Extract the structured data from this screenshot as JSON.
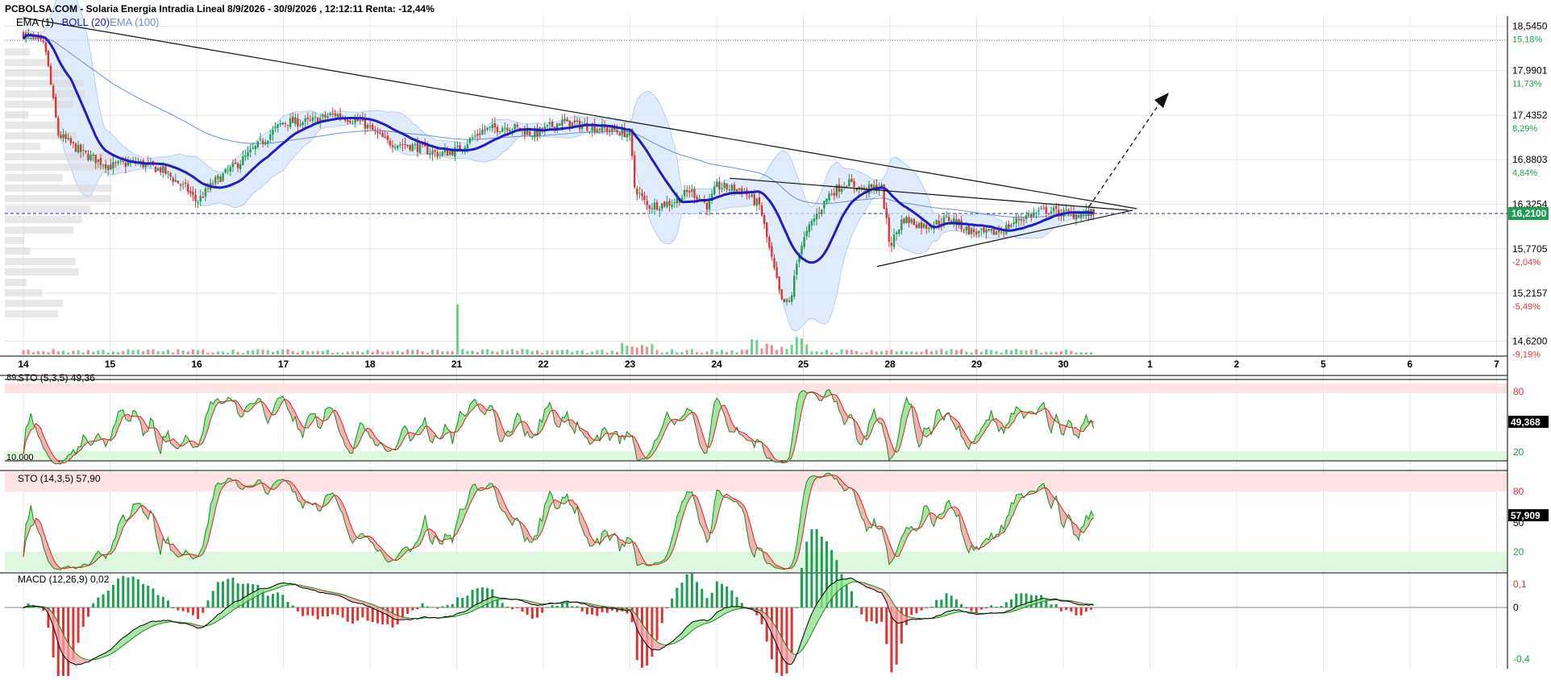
{
  "header": {
    "title": "PCBOLSA.COM - Solaria Energia Intradia Lineal 8/9/2026 - 30/9/2026 , 12:12:11 Renta: -12,44%"
  },
  "legend": {
    "ema1": "EMA (1)",
    "boll": "BOLL (20)",
    "ema100": "EMA (100)"
  },
  "colors": {
    "up": "#1e9e50",
    "down": "#e03434",
    "boll": "#1f1fbf",
    "ema100": "#6b8fd1",
    "band": "#d6e6fa",
    "overbought": "#fde3e3",
    "oversold": "#dff7df",
    "grid": "#e6e6e6"
  },
  "price_axis": {
    "ticks": [
      {
        "price": "18,5450",
        "pct": "15,18%",
        "v": 18.545
      },
      {
        "price": "17,9901",
        "pct": "11,73%",
        "v": 17.9901
      },
      {
        "price": "17,4352",
        "pct": "8,29%",
        "v": 17.4352
      },
      {
        "price": "16,8803",
        "pct": "4,84%",
        "v": 16.8803
      },
      {
        "price": "16,3254",
        "pct": "",
        "v": 16.3254
      },
      {
        "price": "15,7705",
        "pct": "-2,04%",
        "v": 15.7705
      },
      {
        "price": "15,2157",
        "pct": "-5,49%",
        "v": 15.2157
      },
      {
        "price": "14,6200",
        "pct": "-9,19%",
        "v": 14.62
      }
    ],
    "current": "16,2100",
    "current_value": 16.21
  },
  "osc1": {
    "label": "STO (5,3,5)",
    "value": "49,36",
    "current": "49,368",
    "level_low": "10,000",
    "level_top_fragment": "89,",
    "t80": "80",
    "t20": "20"
  },
  "osc2": {
    "label": "STO (14,3,5)",
    "value": "57,90",
    "current": "57,909",
    "t80": "80",
    "t50": "50",
    "t20": "20"
  },
  "macd": {
    "label": "MACD (12,26,9)",
    "value": "0,02",
    "t1": "0,1",
    "t0": "0",
    "tm": "-0,4"
  },
  "chart_data": {
    "type": "line",
    "title": "PCBOLSA.COM - Solaria Energia Intradia Lineal 8/9/2026 - 30/9/2026 , 12:12:11 Renta: -12,44%",
    "x_labels": [
      "14",
      "15",
      "16",
      "17",
      "18",
      "21",
      "22",
      "23",
      "24",
      "25",
      "28",
      "29",
      "30",
      "1",
      "2",
      "5",
      "6",
      "7"
    ],
    "ylim": [
      14.45,
      18.8
    ],
    "price_anchors": [
      [
        0,
        18.45
      ],
      [
        0.25,
        18.3
      ],
      [
        0.4,
        17.2
      ],
      [
        0.7,
        16.95
      ],
      [
        1.0,
        16.8
      ],
      [
        1.3,
        16.85
      ],
      [
        1.6,
        16.75
      ],
      [
        1.9,
        16.5
      ],
      [
        2.0,
        16.35
      ],
      [
        2.2,
        16.6
      ],
      [
        2.5,
        16.85
      ],
      [
        2.8,
        17.15
      ],
      [
        3.0,
        17.35
      ],
      [
        3.3,
        17.35
      ],
      [
        3.6,
        17.45
      ],
      [
        3.9,
        17.35
      ],
      [
        4.2,
        17.1
      ],
      [
        4.5,
        17.05
      ],
      [
        4.8,
        16.95
      ],
      [
        5.0,
        17.0
      ],
      [
        5.3,
        17.25
      ],
      [
        5.6,
        17.3
      ],
      [
        5.9,
        17.2
      ],
      [
        6.2,
        17.35
      ],
      [
        6.5,
        17.3
      ],
      [
        6.8,
        17.25
      ],
      [
        7.0,
        17.2
      ],
      [
        7.05,
        16.55
      ],
      [
        7.2,
        16.3
      ],
      [
        7.5,
        16.35
      ],
      [
        7.7,
        16.5
      ],
      [
        7.9,
        16.3
      ],
      [
        8.0,
        16.55
      ],
      [
        8.3,
        16.5
      ],
      [
        8.5,
        16.3
      ],
      [
        8.6,
        15.8
      ],
      [
        8.75,
        15.1
      ],
      [
        8.85,
        15.1
      ],
      [
        8.95,
        15.75
      ],
      [
        9.1,
        16.1
      ],
      [
        9.3,
        16.45
      ],
      [
        9.5,
        16.6
      ],
      [
        9.7,
        16.5
      ],
      [
        9.9,
        16.55
      ],
      [
        10.0,
        15.8
      ],
      [
        10.15,
        16.15
      ],
      [
        10.4,
        16.05
      ],
      [
        10.7,
        16.15
      ],
      [
        10.9,
        16.0
      ],
      [
        11.1,
        15.95
      ],
      [
        11.3,
        16.0
      ],
      [
        11.5,
        16.15
      ],
      [
        11.8,
        16.25
      ],
      [
        12.1,
        16.2
      ],
      [
        12.35,
        16.21
      ]
    ],
    "trendlines": [
      {
        "name": "upper",
        "from": [
          0,
          18.65
        ],
        "to": [
          12.85,
          16.27
        ]
      },
      {
        "name": "lower",
        "from": [
          9.85,
          15.55
        ],
        "to": [
          12.8,
          16.25
        ]
      },
      {
        "name": "middle",
        "from": [
          8.15,
          16.65
        ],
        "to": [
          12.75,
          16.25
        ]
      }
    ],
    "grid": true,
    "legend_placement": "top-left"
  }
}
